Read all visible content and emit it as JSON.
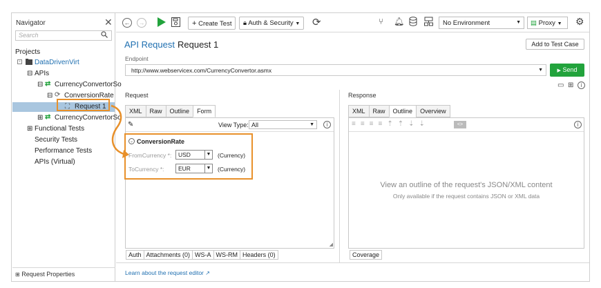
{
  "navigator": {
    "title": "Navigator",
    "close": "✕",
    "search_placeholder": "Search",
    "projects_label": "Projects",
    "tree": {
      "project": "DataDrivenVirt",
      "apis": "APIs",
      "service1": "CurrencyConvertorSo",
      "operation": "ConversionRate",
      "request": "Request 1",
      "service2": "CurrencyConvertorSo",
      "functional": "Functional Tests",
      "security": "Security Tests",
      "performance": "Performance Tests",
      "virtual": "APIs (Virtual)"
    },
    "footer": "Request Properties"
  },
  "toolbar": {
    "create_test": "Create Test",
    "auth_security": "Auth & Security",
    "environment": "No Environment",
    "proxy": "Proxy"
  },
  "header": {
    "title_type": "API Request",
    "title_name": "Request 1",
    "add_to_test_case": "Add to Test Case"
  },
  "endpoint": {
    "label": "Endpoint",
    "value": "http://www.webservicex.com/CurrencyConvertor.asmx",
    "send_label": "Send"
  },
  "request": {
    "label": "Request",
    "tabs": [
      "XML",
      "Raw",
      "Outline",
      "Form"
    ],
    "active_tab": "Form",
    "view_type_label": "View Type:",
    "view_type_value": "All",
    "section": "ConversionRate",
    "fields": [
      {
        "label": "FromCurrency *:",
        "value": "USD",
        "type": "(Currency)"
      },
      {
        "label": "ToCurrency *:",
        "value": "EUR",
        "type": "(Currency)"
      }
    ],
    "bottom_tabs": [
      "Auth",
      "Attachments (0)",
      "WS-A",
      "WS-RM",
      "Headers (0)"
    ]
  },
  "response": {
    "label": "Response",
    "tabs": [
      "XML",
      "Raw",
      "Outline",
      "Overview"
    ],
    "active_tab": "Outline",
    "hint_title": "View an outline of the request's JSON/XML content",
    "hint_sub": "Only available if the request contains JSON or XML data",
    "bottom_tabs": [
      "Coverage"
    ]
  },
  "footer_link": "Learn about the request editor",
  "colors": {
    "accent": "#1f6fb0",
    "send": "#22a33c",
    "highlight": "#e8902a",
    "selection": "#a9c6df"
  }
}
